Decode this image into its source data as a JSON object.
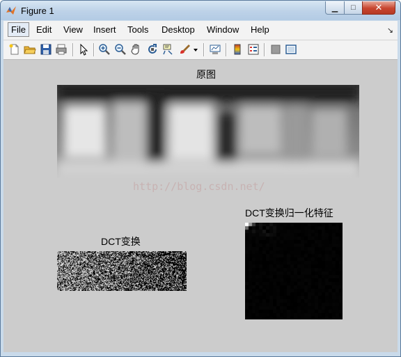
{
  "window": {
    "title": "Figure 1",
    "minimize_glyph": "▁",
    "maximize_glyph": "□",
    "close_glyph": "✕"
  },
  "menubar": {
    "items": [
      {
        "label": "File"
      },
      {
        "label": "Edit"
      },
      {
        "label": "View"
      },
      {
        "label": "Insert"
      },
      {
        "label": "Tools"
      },
      {
        "label": "Desktop"
      },
      {
        "label": "Window"
      },
      {
        "label": "Help"
      }
    ],
    "dock_glyph": "↘"
  },
  "toolbar": {
    "icons": [
      "new-figure-icon",
      "open-file-icon",
      "save-figure-icon",
      "print-figure-icon",
      "edit-plot-arrow-icon",
      "zoom-in-icon",
      "zoom-out-icon",
      "pan-hand-icon",
      "rotate-3d-icon",
      "data-cursor-icon",
      "brush-icon",
      "brush-dropdown-icon",
      "link-plot-icon",
      "insert-colorbar-icon",
      "insert-legend-icon",
      "hide-plot-tools-icon",
      "show-plot-tools-icon"
    ]
  },
  "axes": {
    "original": {
      "title": "原图"
    },
    "dct": {
      "title": "DCT变换"
    },
    "dct_normalized": {
      "title": "DCT变换归一化特征"
    }
  },
  "watermark": "http://blog.csdn.net/",
  "colors": {
    "titlebar": "#bdd2e8",
    "figure_bg": "#cccccc",
    "close_button": "#c7452f",
    "watermark": "#c7b2b2"
  }
}
